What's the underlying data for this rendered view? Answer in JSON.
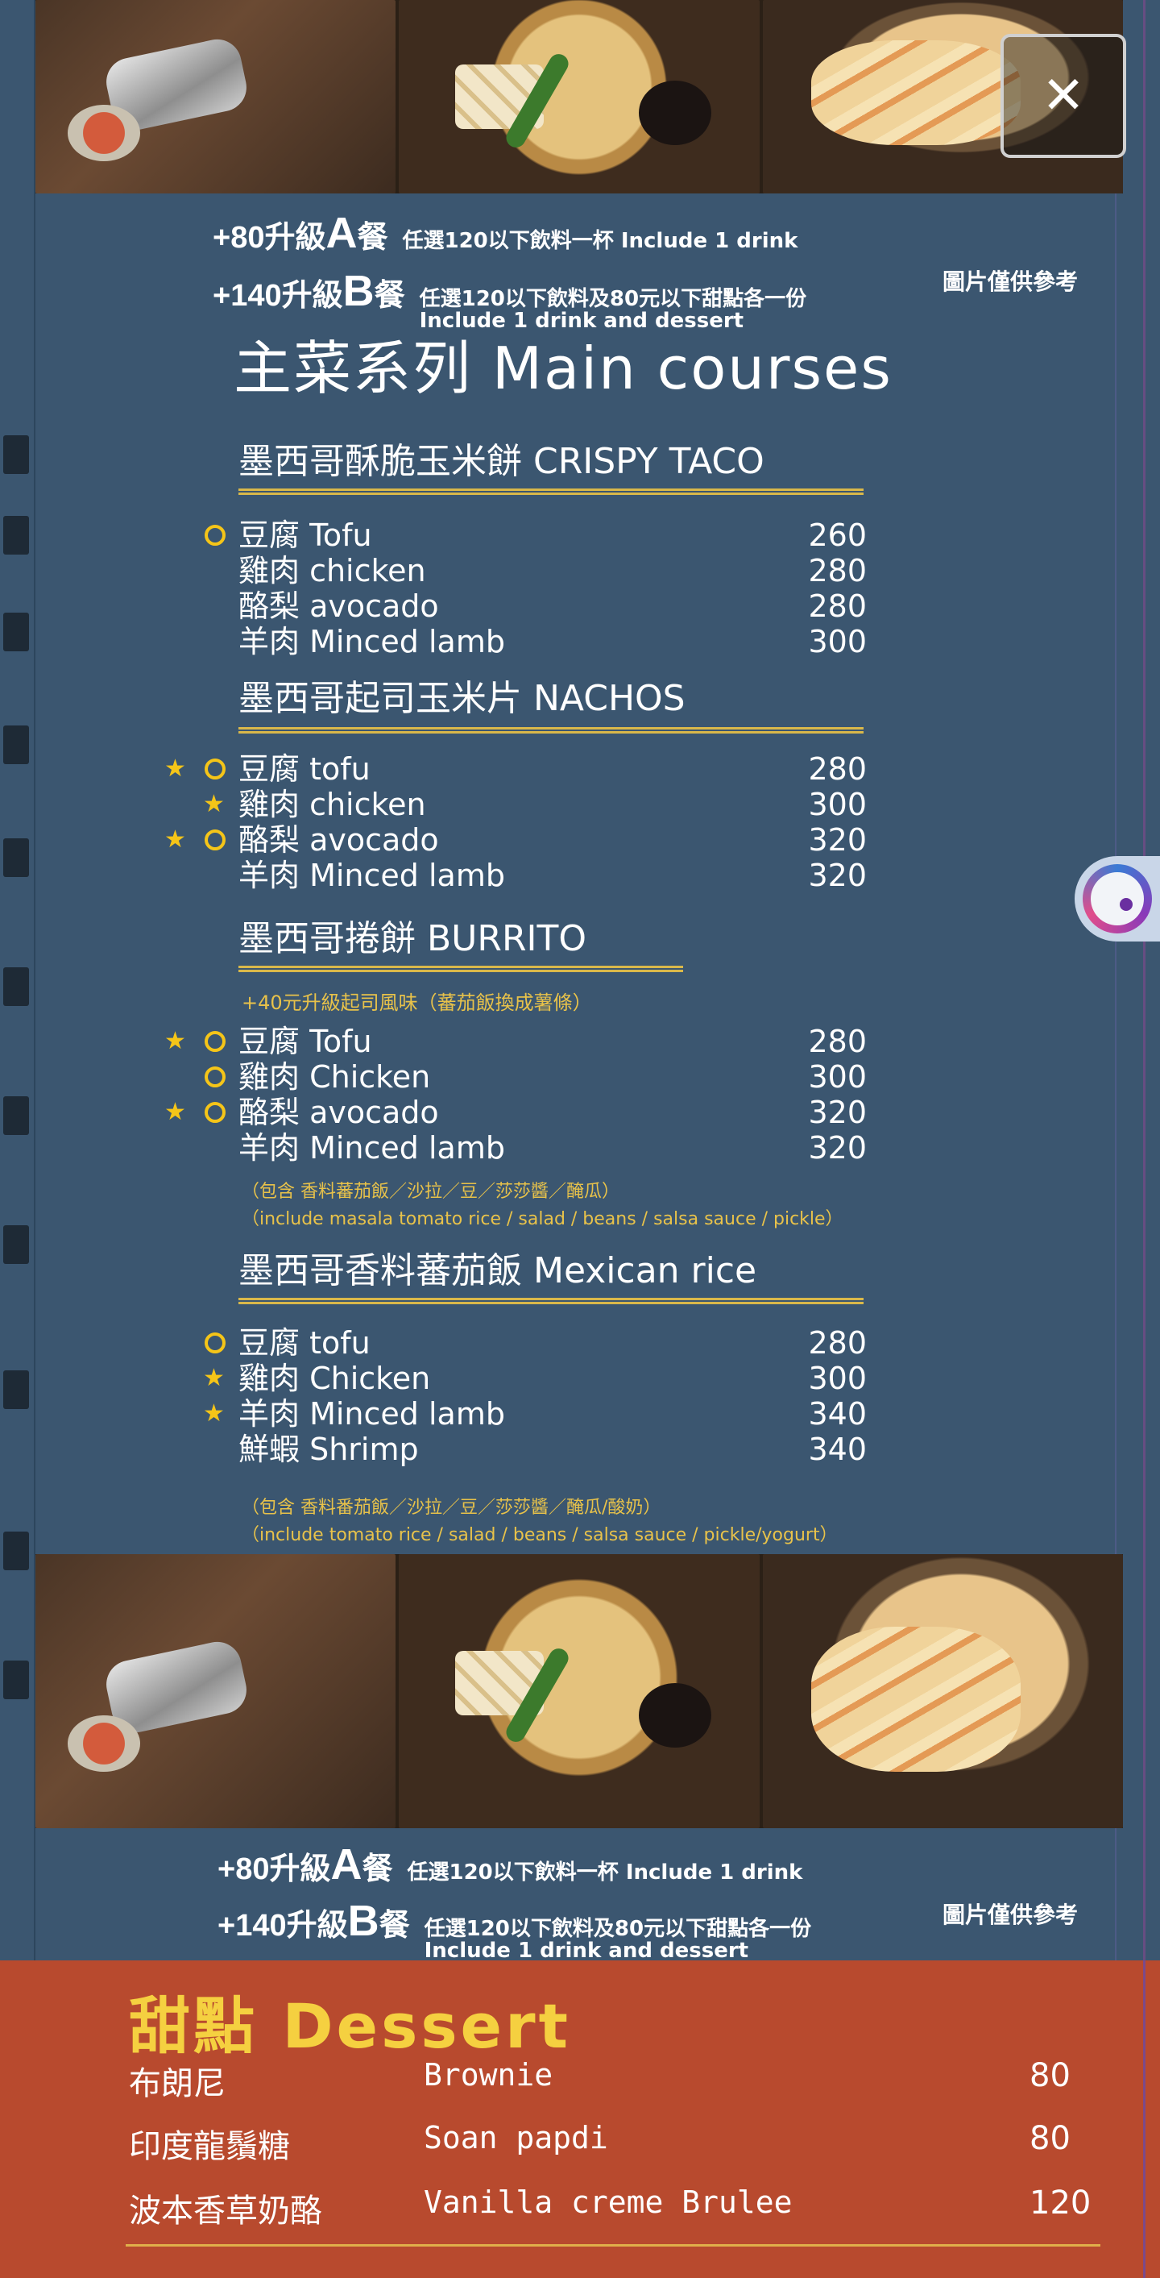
{
  "upgrade_top": {
    "a_price": "+80",
    "a_label": "升級",
    "a_letter": "A",
    "a_suffix": "餐",
    "a_note": "任選120以下飲料一杯 Include 1 drink",
    "b_price": "+140",
    "b_label": "升級",
    "b_letter": "B",
    "b_suffix": "餐",
    "b_note_zh": "任選120以下飲料及80元以下甜點各一份",
    "b_note_en": "Include 1 drink and dessert",
    "ref": "圖片僅供參考"
  },
  "main_title": "主菜系列 Main courses",
  "sections": [
    {
      "head": "墨西哥酥脆玉米餅 CRISPY TACO",
      "items": [
        {
          "name": "豆腐 Tofu",
          "price": "260",
          "star": false,
          "circle": true
        },
        {
          "name": "雞肉 chicken",
          "price": "280",
          "star": false,
          "circle": false
        },
        {
          "name": "酪梨 avocado",
          "price": "280",
          "star": false,
          "circle": false
        },
        {
          "name": "羊肉 Minced lamb",
          "price": "300",
          "star": false,
          "circle": false
        }
      ]
    },
    {
      "head": "墨西哥起司玉米片 NACHOS",
      "items": [
        {
          "name": "豆腐 tofu",
          "price": "280",
          "star": true,
          "circle": true
        },
        {
          "name": "雞肉 chicken",
          "price": "300",
          "star": true,
          "circle": false
        },
        {
          "name": "酪梨 avocado",
          "price": "320",
          "star": true,
          "circle": true
        },
        {
          "name": "羊肉 Minced lamb",
          "price": "320",
          "star": false,
          "circle": false
        }
      ]
    },
    {
      "head": "墨西哥捲餅 BURRITO",
      "subnote": "+40元升級起司風味（蕃茄飯換成薯條）",
      "items": [
        {
          "name": "豆腐 Tofu",
          "price": "280",
          "star": true,
          "circle": true
        },
        {
          "name": "雞肉 Chicken",
          "price": "300",
          "star": false,
          "circle": true
        },
        {
          "name": "酪梨 avocado",
          "price": "320",
          "star": true,
          "circle": true
        },
        {
          "name": "羊肉 Minced lamb",
          "price": "320",
          "star": false,
          "circle": false
        }
      ],
      "footnote_zh": "（包含 香料蕃茄飯／沙拉／豆／莎莎醬／醃瓜）",
      "footnote_en": "（include masala tomato rice / salad / beans / salsa sauce / pickle）"
    },
    {
      "head": "墨西哥香料蕃茄飯 Mexican rice",
      "items": [
        {
          "name": "豆腐 tofu",
          "price": "280",
          "star": false,
          "circle": true
        },
        {
          "name": "雞肉 Chicken",
          "price": "300",
          "star": true,
          "circle": false
        },
        {
          "name": "羊肉 Minced lamb",
          "price": "340",
          "star": true,
          "circle": false
        },
        {
          "name": "鮮蝦 Shrimp",
          "price": "340",
          "star": false,
          "circle": false
        }
      ],
      "footnote_zh": "（包含 香料番茄飯／沙拉／豆／莎莎醬／醃瓜/酸奶）",
      "footnote_en": "（include tomato rice / salad / beans / salsa sauce / pickle/yogurt）"
    }
  ],
  "upgrade_bottom": {
    "a_price": "+80",
    "a_label": "升級",
    "a_letter": "A",
    "a_suffix": "餐",
    "a_note": "任選120以下飲料一杯 Include 1 drink",
    "b_price": "+140",
    "b_label": "升級",
    "b_letter": "B",
    "b_suffix": "餐",
    "b_note_zh": "任選120以下飲料及80元以下甜點各一份",
    "b_note_en": "Include 1 drink and dessert",
    "ref": "圖片僅供參考"
  },
  "dessert": {
    "title": "甜點 Dessert",
    "items": [
      {
        "zh": "布朗尼",
        "en": "Brownie",
        "price": "80"
      },
      {
        "zh": "印度龍鬚糖",
        "en": "Soan papdi",
        "price": "80"
      },
      {
        "zh": "波本香草奶酪",
        "en": "Vanilla creme Brulee",
        "price": "120"
      }
    ]
  },
  "viewer": {
    "close_icon": "close-icon",
    "float_icon": "assistant-bubble-icon"
  },
  "colors": {
    "menu_bg": "#3b5670",
    "dessert_bg": "#b84a2e",
    "accent_gold": "#f5c518"
  }
}
